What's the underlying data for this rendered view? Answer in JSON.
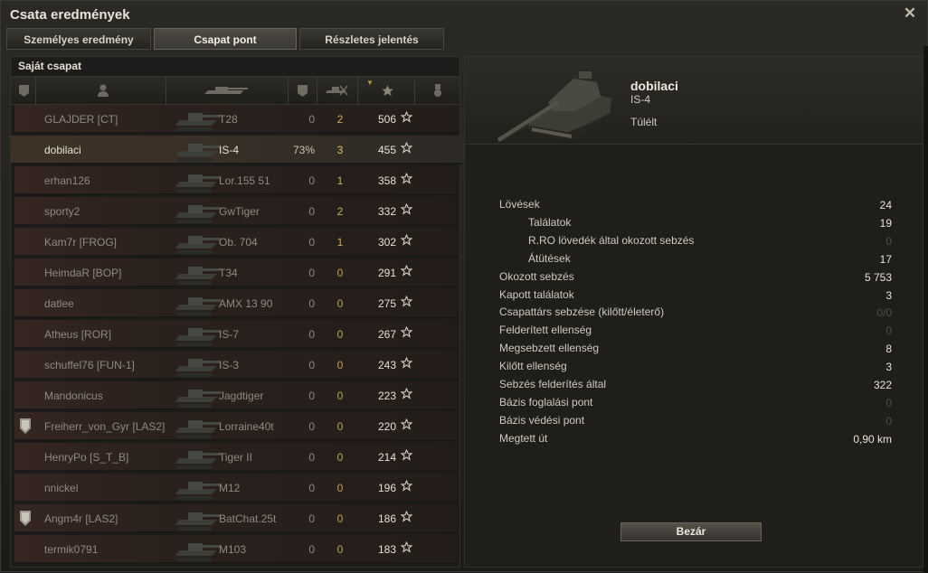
{
  "window": {
    "title": "Csata eredmények"
  },
  "tabs": [
    {
      "label": "Személyes eredmény",
      "active": false
    },
    {
      "label": "Csapat pont",
      "active": true
    },
    {
      "label": "Részletes jelentés",
      "active": false
    }
  ],
  "team": {
    "header": "Saját csapat",
    "columns": [
      "medal-icon",
      "player-icon",
      "tank-icon",
      "damage-icon",
      "kills-icon",
      "xp-star-icon",
      "achievement-icon"
    ],
    "rows": [
      {
        "player": "GLAJDER [CT]",
        "tank": "T28",
        "damage": "0",
        "kills": "2",
        "xp": "506",
        "medal": false,
        "me": false
      },
      {
        "player": "dobilaci",
        "tank": "IS-4",
        "damage": "73%",
        "kills": "3",
        "xp": "455",
        "medal": false,
        "me": true
      },
      {
        "player": "erhan126",
        "tank": "Lor.155 51",
        "damage": "0",
        "kills": "1",
        "xp": "358",
        "medal": false,
        "me": false
      },
      {
        "player": "sporty2",
        "tank": "GwTiger",
        "damage": "0",
        "kills": "2",
        "xp": "332",
        "medal": false,
        "me": false
      },
      {
        "player": "Kam7r [FROG]",
        "tank": "Ob. 704",
        "damage": "0",
        "kills": "1",
        "xp": "302",
        "medal": false,
        "me": false
      },
      {
        "player": "HeimdaR [BOP]",
        "tank": "T34",
        "damage": "0",
        "kills": "0",
        "xp": "291",
        "medal": false,
        "me": false
      },
      {
        "player": "datlee",
        "tank": "AMX 13 90",
        "damage": "0",
        "kills": "0",
        "xp": "275",
        "medal": false,
        "me": false
      },
      {
        "player": "Atheus [ROR]",
        "tank": "IS-7",
        "damage": "0",
        "kills": "0",
        "xp": "267",
        "medal": false,
        "me": false
      },
      {
        "player": "schuffel76 [FUN-1]",
        "tank": "IS-3",
        "damage": "0",
        "kills": "0",
        "xp": "243",
        "medal": false,
        "me": false
      },
      {
        "player": "Mandonicus",
        "tank": "Jagdtiger",
        "damage": "0",
        "kills": "0",
        "xp": "223",
        "medal": false,
        "me": false
      },
      {
        "player": "Freiherr_von_Gyr [LAS2]",
        "tank": "Lorraine40t",
        "damage": "0",
        "kills": "0",
        "xp": "220",
        "medal": true,
        "me": false
      },
      {
        "player": "HenryPo [S_T_B]",
        "tank": "Tiger II",
        "damage": "0",
        "kills": "0",
        "xp": "214",
        "medal": false,
        "me": false
      },
      {
        "player": "nnickel",
        "tank": "M12",
        "damage": "0",
        "kills": "0",
        "xp": "196",
        "medal": false,
        "me": false
      },
      {
        "player": "Angm4r [LAS2]",
        "tank": "BatChat.25t",
        "damage": "0",
        "kills": "0",
        "xp": "186",
        "medal": true,
        "me": false
      },
      {
        "player": "termik0791",
        "tank": "M103",
        "damage": "0",
        "kills": "0",
        "xp": "183",
        "medal": false,
        "me": false
      }
    ]
  },
  "details": {
    "player": "dobilaci",
    "tank": "IS-4",
    "status": "Túlélt",
    "stats": [
      {
        "label": "Lövések",
        "value": "24",
        "sub": false,
        "dim": false
      },
      {
        "label": "Találatok",
        "value": "19",
        "sub": true,
        "dim": false
      },
      {
        "label": "R.RO lövedék által okozott sebzés",
        "value": "0",
        "sub": true,
        "dim": true
      },
      {
        "label": "Átütések",
        "value": "17",
        "sub": true,
        "dim": false
      },
      {
        "label": "Okozott sebzés",
        "value": "5 753",
        "sub": false,
        "dim": false
      },
      {
        "label": "Kapott találatok",
        "value": "3",
        "sub": false,
        "dim": false
      },
      {
        "label": "Csapattárs sebzése (kilőtt/életerő)",
        "value": "0/0",
        "sub": false,
        "dim": true
      },
      {
        "label": "Felderített ellenség",
        "value": "0",
        "sub": false,
        "dim": true
      },
      {
        "label": "Megsebzett ellenség",
        "value": "8",
        "sub": false,
        "dim": false
      },
      {
        "label": "Kilőtt ellenség",
        "value": "3",
        "sub": false,
        "dim": false
      },
      {
        "label": "Sebzés felderítés által",
        "value": "322",
        "sub": false,
        "dim": false
      },
      {
        "label": "Bázis foglalási pont",
        "value": "0",
        "sub": false,
        "dim": true
      },
      {
        "label": "Bázis védési pont",
        "value": "0",
        "sub": false,
        "dim": true
      },
      {
        "label": "Megtett út",
        "value": "0,90 km",
        "sub": false,
        "dim": false
      }
    ],
    "close_label": "Bezár"
  }
}
